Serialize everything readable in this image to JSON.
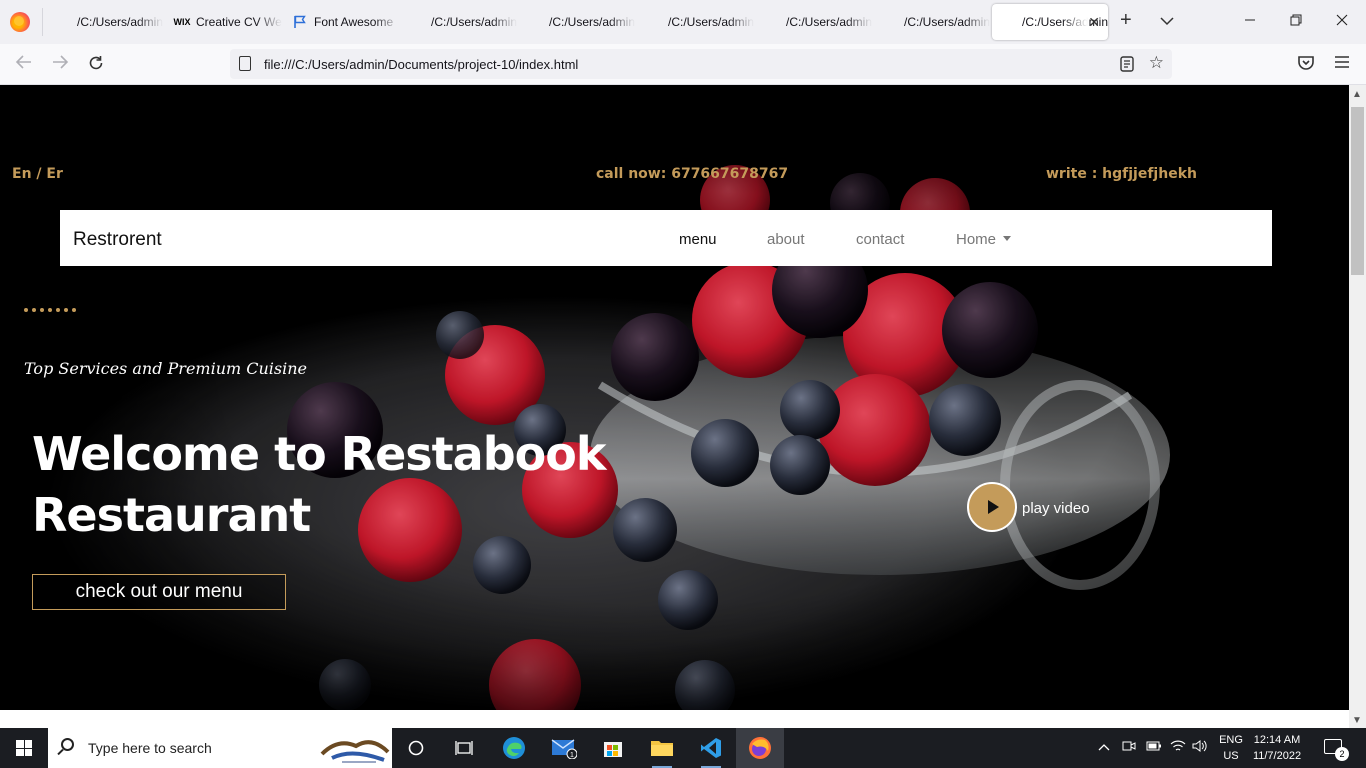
{
  "browser": {
    "tabs": [
      {
        "title": "/C:/Users/admin/Documents",
        "favicon": "file"
      },
      {
        "title": "Creative CV Website",
        "favicon": "wix"
      },
      {
        "title": "Font Awesome",
        "favicon": "flag"
      },
      {
        "title": "/C:/Users/admin/Documents",
        "favicon": "file"
      },
      {
        "title": "/C:/Users/admin/Documents",
        "favicon": "file"
      },
      {
        "title": "/C:/Users/admin/Documents",
        "favicon": "file"
      },
      {
        "title": "/C:/Users/admin/Documents",
        "favicon": "file"
      },
      {
        "title": "/C:/Users/admin/Documents",
        "favicon": "file"
      },
      {
        "title": "/C:/Users/admin/Documents",
        "favicon": "file",
        "active": true
      }
    ],
    "url": "file:///C:/Users/admin/Documents/project-10/index.html"
  },
  "site": {
    "lang": "En / Er",
    "call": "call now: 677667678767",
    "write": "write : hgfjjefjhekh",
    "brand": "Restrorent",
    "nav": {
      "menu": "menu",
      "about": "about",
      "contact": "contact",
      "home": "Home"
    },
    "tagline": "Top Services and Premium Cuisine",
    "headline_line1": "Welcome to Restabook",
    "headline_line2": "Restaurant",
    "cta": "check out our menu",
    "play_label": "play video",
    "accent": "#c49b5a"
  },
  "taskbar": {
    "search_placeholder": "Type here to search",
    "lang_top": "ENG",
    "lang_bottom": "US",
    "time": "12:14 AM",
    "date": "11/7/2022",
    "mail_badge": "1",
    "notifications": "2"
  }
}
